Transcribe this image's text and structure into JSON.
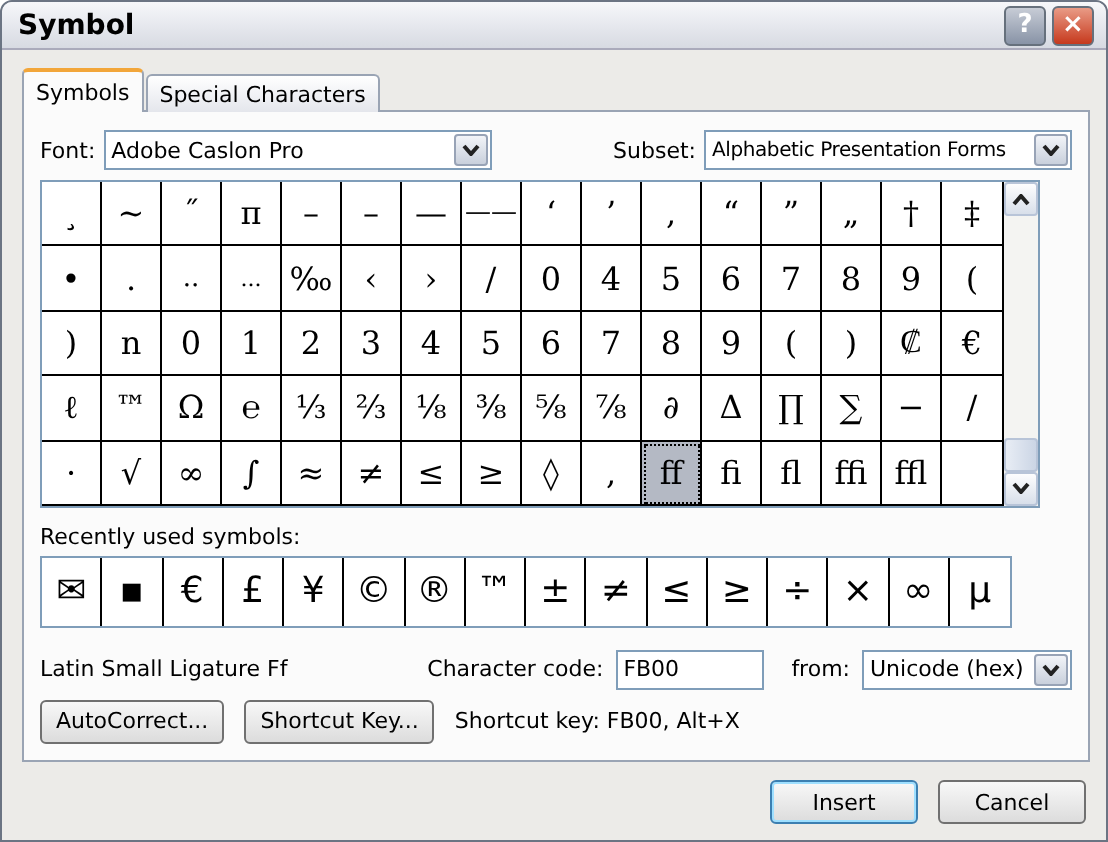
{
  "window": {
    "title": "Symbol",
    "help": "?",
    "close": "×"
  },
  "tabs": [
    {
      "label": "Symbols",
      "selected": true
    },
    {
      "label": "Special Characters",
      "selected": false
    }
  ],
  "font": {
    "label": "Font:",
    "value": "Adobe Caslon Pro"
  },
  "subset": {
    "label": "Subset:",
    "value": "Alphabetic Presentation Forms"
  },
  "grid": [
    [
      {
        "char": "¸",
        "selected": false
      },
      {
        "char": "~",
        "selected": false
      },
      {
        "char": "˝",
        "selected": false
      },
      {
        "char": "π",
        "selected": false
      },
      {
        "char": "–",
        "selected": false
      },
      {
        "char": "–",
        "selected": false
      },
      {
        "char": "—",
        "selected": false
      },
      {
        "char": "——",
        "selected": false
      },
      {
        "char": "‘",
        "selected": false
      },
      {
        "char": "’",
        "selected": false
      },
      {
        "char": ",",
        "selected": false
      },
      {
        "char": "“",
        "selected": false
      },
      {
        "char": "”",
        "selected": false
      },
      {
        "char": "„",
        "selected": false
      },
      {
        "char": "†",
        "selected": false
      },
      {
        "char": "‡",
        "selected": false
      }
    ],
    [
      {
        "char": "•",
        "selected": false
      },
      {
        "char": ".",
        "selected": false
      },
      {
        "char": "..",
        "selected": false
      },
      {
        "char": "...",
        "selected": false
      },
      {
        "char": "‰",
        "selected": false
      },
      {
        "char": "‹",
        "selected": false
      },
      {
        "char": "›",
        "selected": false
      },
      {
        "char": "/",
        "selected": false
      },
      {
        "char": "0",
        "selected": false
      },
      {
        "char": "4",
        "selected": false
      },
      {
        "char": "5",
        "selected": false
      },
      {
        "char": "6",
        "selected": false
      },
      {
        "char": "7",
        "selected": false
      },
      {
        "char": "8",
        "selected": false
      },
      {
        "char": "9",
        "selected": false
      },
      {
        "char": "(",
        "selected": false
      }
    ],
    [
      {
        "char": ")",
        "selected": false
      },
      {
        "char": "n",
        "selected": false
      },
      {
        "char": "0",
        "selected": false
      },
      {
        "char": "1",
        "selected": false
      },
      {
        "char": "2",
        "selected": false
      },
      {
        "char": "3",
        "selected": false
      },
      {
        "char": "4",
        "selected": false
      },
      {
        "char": "5",
        "selected": false
      },
      {
        "char": "6",
        "selected": false
      },
      {
        "char": "7",
        "selected": false
      },
      {
        "char": "8",
        "selected": false
      },
      {
        "char": "9",
        "selected": false
      },
      {
        "char": "(",
        "selected": false
      },
      {
        "char": ")",
        "selected": false
      },
      {
        "char": "₡",
        "selected": false
      },
      {
        "char": "€",
        "selected": false
      }
    ],
    [
      {
        "char": "ℓ",
        "selected": false
      },
      {
        "char": "™",
        "selected": false
      },
      {
        "char": "Ω",
        "selected": false
      },
      {
        "char": "℮",
        "selected": false
      },
      {
        "char": "⅓",
        "selected": false
      },
      {
        "char": "⅔",
        "selected": false
      },
      {
        "char": "⅛",
        "selected": false
      },
      {
        "char": "⅜",
        "selected": false
      },
      {
        "char": "⅝",
        "selected": false
      },
      {
        "char": "⅞",
        "selected": false
      },
      {
        "char": "∂",
        "selected": false
      },
      {
        "char": "Δ",
        "selected": false
      },
      {
        "char": "∏",
        "selected": false
      },
      {
        "char": "∑",
        "selected": false
      },
      {
        "char": "−",
        "selected": false
      },
      {
        "char": "∕",
        "selected": false
      }
    ],
    [
      {
        "char": "·",
        "selected": false
      },
      {
        "char": "√",
        "selected": false
      },
      {
        "char": "∞",
        "selected": false
      },
      {
        "char": "∫",
        "selected": false
      },
      {
        "char": "≈",
        "selected": false
      },
      {
        "char": "≠",
        "selected": false
      },
      {
        "char": "≤",
        "selected": false
      },
      {
        "char": "≥",
        "selected": false
      },
      {
        "char": "◊",
        "selected": false
      },
      {
        "char": ",",
        "selected": false
      },
      {
        "char": "ﬀ",
        "selected": true
      },
      {
        "char": "ﬁ",
        "selected": false
      },
      {
        "char": "ﬂ",
        "selected": false
      },
      {
        "char": "ﬃ",
        "selected": false
      },
      {
        "char": "ﬄ",
        "selected": false
      }
    ]
  ],
  "recent": {
    "label": "Recently used symbols:",
    "symbols": [
      "✉",
      "▪",
      "€",
      "£",
      "¥",
      "©",
      "®",
      "™",
      "±",
      "≠",
      "≤",
      "≥",
      "÷",
      "×",
      "∞",
      "µ"
    ]
  },
  "description": "Latin Small Ligature Ff",
  "character_code": {
    "label": "Character code:",
    "value": "FB00"
  },
  "from": {
    "label": "from:",
    "value": "Unicode (hex)"
  },
  "buttons": [
    {
      "label": "AutoCorrect..."
    },
    {
      "label": "Shortcut Key..."
    }
  ],
  "shortcut_text": "Shortcut key: FB00, Alt+X",
  "footer_buttons": [
    {
      "label": "Insert",
      "default": true
    },
    {
      "label": "Cancel",
      "default": false
    }
  ]
}
